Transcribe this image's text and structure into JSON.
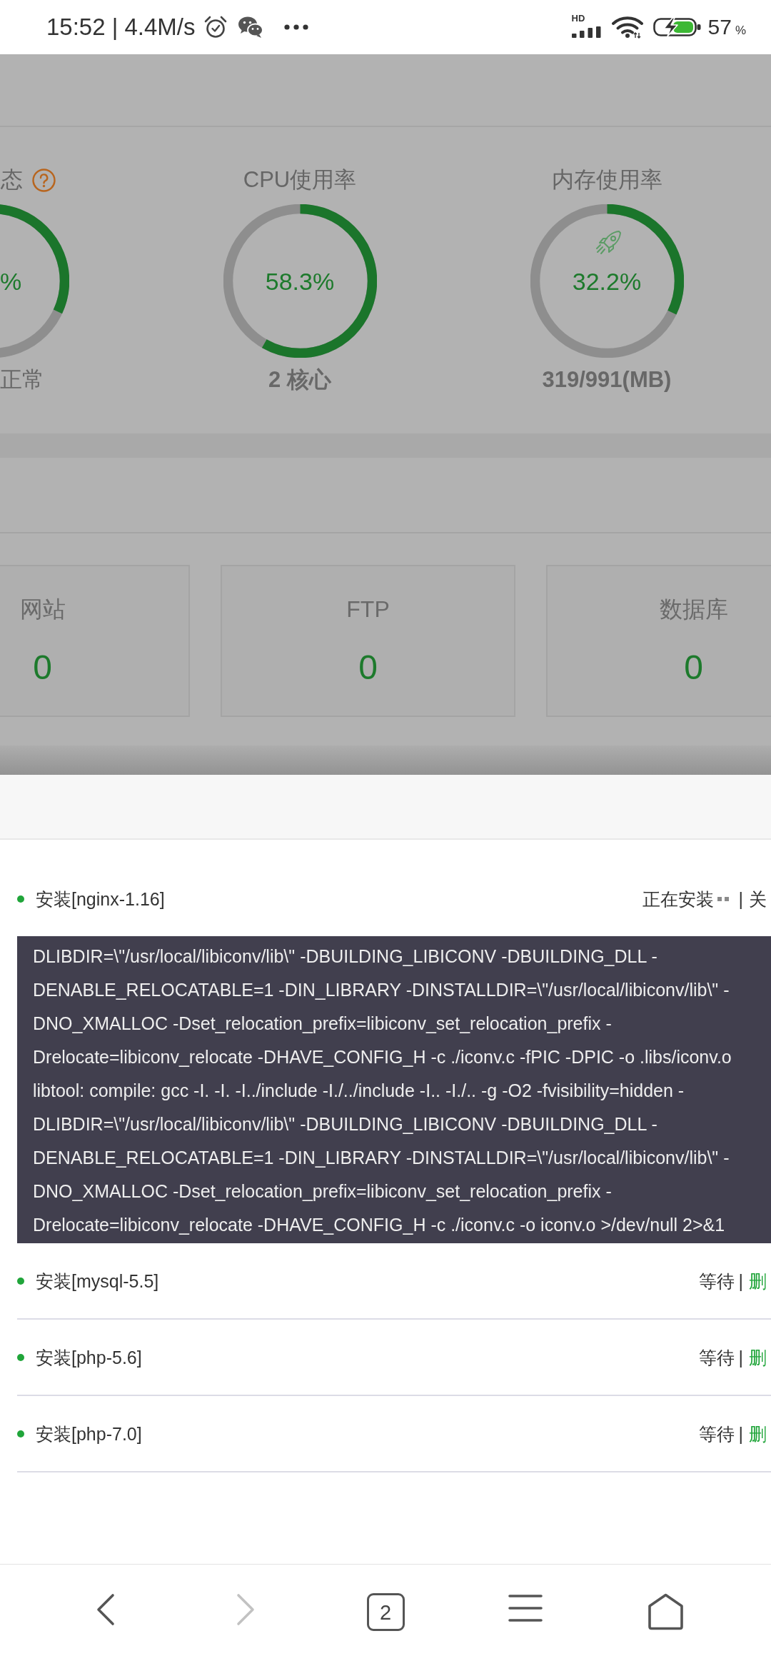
{
  "status_bar": {
    "time_and_speed": "15:52 | 4.4M/s",
    "network_label": "HD",
    "battery_percent": "57",
    "battery_unit": "%"
  },
  "dashboard": {
    "gauges": [
      {
        "kind": "load",
        "title": "态",
        "value": "%",
        "level": 0.32,
        "caption": "正常"
      },
      {
        "kind": "cpu",
        "title": "CPU使用率",
        "value": "58.3%",
        "level": 0.583,
        "caption": "2 核心"
      },
      {
        "kind": "memory",
        "title": "内存使用率",
        "value": "32.2%",
        "level": 0.322,
        "caption": "319/991(MB)"
      }
    ],
    "stats": [
      {
        "label": "网站",
        "value": "0"
      },
      {
        "label": "FTP",
        "value": "0"
      },
      {
        "label": "数据库",
        "value": "0"
      }
    ]
  },
  "task_sheet": {
    "tasks": [
      {
        "kind": "running",
        "name": "安装[nginx-1.16]",
        "status": "正在安装",
        "divider": "|",
        "action": "关",
        "log": [
          "DLIBDIR=\\\"/usr/local/libiconv/lib\\\" -DBUILDING_LIBICONV -DBUILDING_DLL -",
          "DENABLE_RELOCATABLE=1 -DIN_LIBRARY -DINSTALLDIR=\\\"/usr/local/libiconv/lib\\\" -",
          "DNO_XMALLOC -Dset_relocation_prefix=libiconv_set_relocation_prefix -",
          "Drelocate=libiconv_relocate -DHAVE_CONFIG_H -c ./iconv.c -fPIC -DPIC -o .libs/iconv.o",
          "libtool: compile: gcc -I. -I. -I../include -I./../include -I.. -I./.. -g -O2 -fvisibility=hidden -",
          "DLIBDIR=\\\"/usr/local/libiconv/lib\\\" -DBUILDING_LIBICONV -DBUILDING_DLL -",
          "DENABLE_RELOCATABLE=1 -DIN_LIBRARY -DINSTALLDIR=\\\"/usr/local/libiconv/lib\\\" -",
          "DNO_XMALLOC -Dset_relocation_prefix=libiconv_set_relocation_prefix -",
          "Drelocate=libiconv_relocate -DHAVE_CONFIG_H -c ./iconv.c -o iconv.o >/dev/null 2>&1"
        ]
      },
      {
        "kind": "waiting",
        "name": "安装[mysql-5.5]",
        "status": "等待",
        "divider": "|",
        "action": "删"
      },
      {
        "kind": "waiting",
        "name": "安装[php-5.6]",
        "status": "等待",
        "divider": "|",
        "action": "删"
      },
      {
        "kind": "waiting",
        "name": "安装[php-7.0]",
        "status": "等待",
        "divider": "|",
        "action": "删"
      }
    ]
  },
  "nav_bar": {
    "back": {
      "disabled": false
    },
    "forward": {
      "disabled": true
    },
    "tab_count": "2"
  }
}
